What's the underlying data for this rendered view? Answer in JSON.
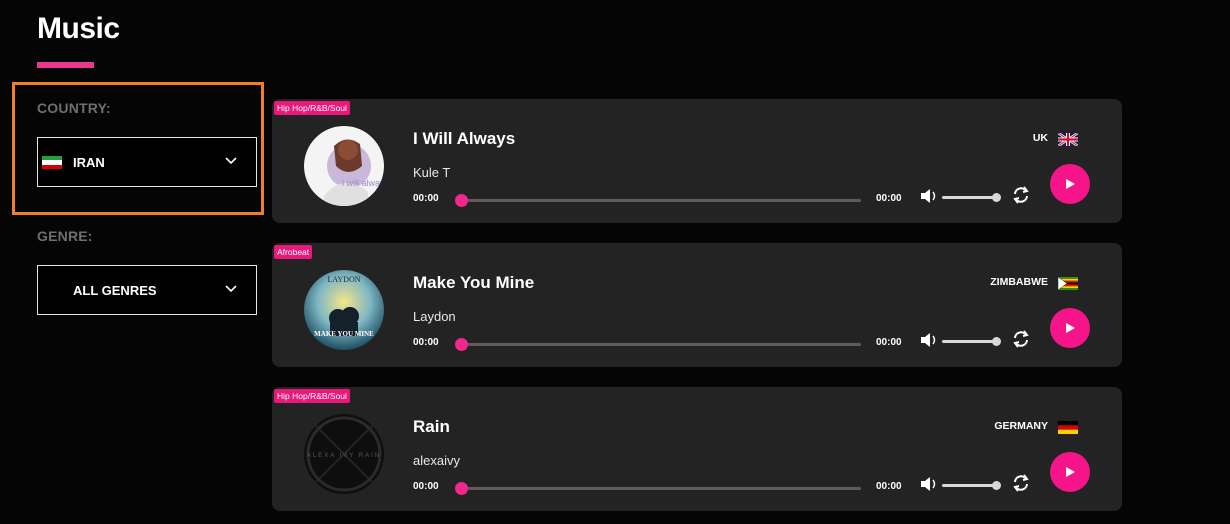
{
  "page": {
    "title": "Music"
  },
  "filters": {
    "country_label": "COUNTRY:",
    "country_value": "IRAN",
    "genre_label": "GENRE:",
    "genre_value": "ALL GENRES"
  },
  "colors": {
    "accent": "#f5148a",
    "highlight": "#f07f2a",
    "card_bg": "#232323"
  },
  "tracks": [
    {
      "genre": "Hip Hop/R&B/Soul",
      "title": "I Will Always",
      "artist": "Kule T",
      "current_time": "00:00",
      "duration": "00:00",
      "country": "UK",
      "flag_icon": "uk-flag-icon",
      "cover_text": "i will always"
    },
    {
      "genre": "Afrobeat",
      "title": "Make You Mine",
      "artist": "Laydon",
      "current_time": "00:00",
      "duration": "00:00",
      "country": "ZIMBABWE",
      "flag_icon": "zimbabwe-flag-icon",
      "cover_text": "LAYDON",
      "cover_text_2": "MAKE YOU MINE"
    },
    {
      "genre": "Hip Hop/R&B/Soul",
      "title": "Rain",
      "artist": "alexaivy",
      "current_time": "00:00",
      "duration": "00:00",
      "country": "GERMANY",
      "flag_icon": "germany-flag-icon",
      "cover_text": "ALEXA IVY RAIN"
    }
  ]
}
